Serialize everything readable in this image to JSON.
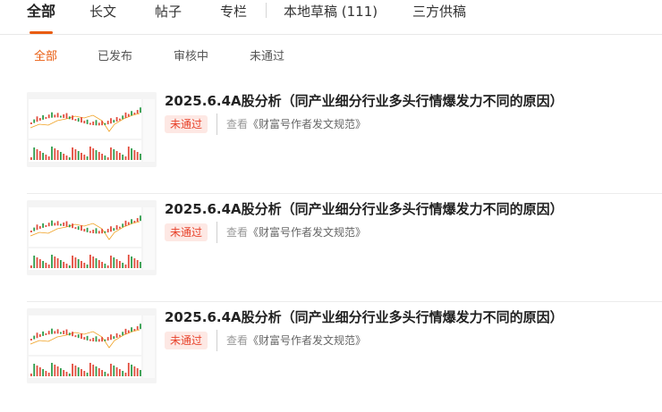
{
  "top_tabs": [
    {
      "label": "全部",
      "active": true
    },
    {
      "label": "长文",
      "active": false
    },
    {
      "label": "帖子",
      "active": false
    },
    {
      "label": "专栏",
      "active": false
    },
    {
      "label": "本地草稿 (111)",
      "active": false
    },
    {
      "label": "三方供稿",
      "active": false
    }
  ],
  "sub_tabs": [
    {
      "label": "全部",
      "active": true
    },
    {
      "label": "已发布",
      "active": false
    },
    {
      "label": "审核中",
      "active": false
    },
    {
      "label": "未通过",
      "active": false
    }
  ],
  "articles": [
    {
      "title": "2025.6.4A股分析（同产业细分行业多头行情爆发力不同的原因）",
      "status": "未通过",
      "hint_prefix": "查看",
      "hint_link": "《财富号作者发文规范》"
    },
    {
      "title": "2025.6.4A股分析（同产业细分行业多头行情爆发力不同的原因）",
      "status": "未通过",
      "hint_prefix": "查看",
      "hint_link": "《财富号作者发文规范》"
    },
    {
      "title": "2025.6.4A股分析（同产业细分行业多头行情爆发力不同的原因）",
      "status": "未通过",
      "hint_prefix": "查看",
      "hint_link": "《财富号作者发文规范》"
    }
  ],
  "colors": {
    "accent": "#e95c0f",
    "status_bg": "#fde8e4",
    "status_text": "#e8432c"
  }
}
